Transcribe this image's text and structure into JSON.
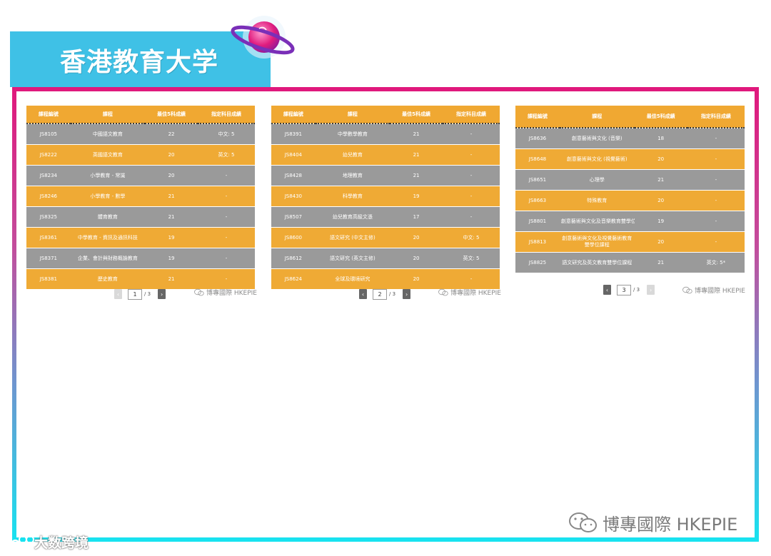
{
  "banner": {
    "title": "香港教育大学"
  },
  "columns": [
    "課程編號",
    "課程",
    "最佳5科成績",
    "指定科目成績"
  ],
  "panel3_columns": [
    "課程編號",
    "課程",
    "最佳5科成績",
    "指定科目成績"
  ],
  "panels": [
    {
      "rows": [
        {
          "code": "JS8105",
          "course": "中國語文教育",
          "score": "22",
          "req": "中文: 5"
        },
        {
          "code": "JS8222",
          "course": "英國語文教育",
          "score": "20",
          "req": "英文: 5"
        },
        {
          "code": "JS8234",
          "course": "小學教育 - 常識",
          "score": "20",
          "req": "-"
        },
        {
          "code": "JS8246",
          "course": "小學教育 - 數學",
          "score": "21",
          "req": "-"
        },
        {
          "code": "JS8325",
          "course": "體育教育",
          "score": "21",
          "req": "-"
        },
        {
          "code": "JS8361",
          "course": "中學教育 - 資訊及通訊科技",
          "score": "19",
          "req": "-"
        },
        {
          "code": "JS8371",
          "course": "企業、會計與財務概論教育",
          "score": "19",
          "req": "-"
        },
        {
          "code": "JS8381",
          "course": "歷史教育",
          "score": "21",
          "req": "-"
        }
      ],
      "pager": {
        "page": "1",
        "total": "/ 3"
      }
    },
    {
      "rows": [
        {
          "code": "JS8391",
          "course": "中學數學教育",
          "score": "21",
          "req": "-"
        },
        {
          "code": "JS8404",
          "course": "幼兒教育",
          "score": "21",
          "req": "-"
        },
        {
          "code": "JS8428",
          "course": "地理教育",
          "score": "21",
          "req": "-"
        },
        {
          "code": "JS8430",
          "course": "科學教育",
          "score": "19",
          "req": "-"
        },
        {
          "code": "JS8507",
          "course": "幼兒教育高級文憑",
          "score": "17",
          "req": "-"
        },
        {
          "code": "JS8600",
          "course": "語文研究 (中文主修)",
          "score": "20",
          "req": "中文: 5"
        },
        {
          "code": "JS8612",
          "course": "語文研究 (英文主修)",
          "score": "20",
          "req": "英文: 5"
        },
        {
          "code": "JS8624",
          "course": "全球及環境研究",
          "score": "20",
          "req": "-"
        }
      ],
      "pager": {
        "page": "2",
        "total": "/ 3"
      }
    },
    {
      "rows": [
        {
          "code": "JS8636",
          "course": "創意藝術與文化 (音樂)",
          "score": "18",
          "req": "-"
        },
        {
          "code": "JS8648",
          "course": "創意藝術與文化 (視覺藝術)",
          "score": "20",
          "req": "-"
        },
        {
          "code": "JS8651",
          "course": "心理學",
          "score": "21",
          "req": "-"
        },
        {
          "code": "JS8663",
          "course": "特殊教育",
          "score": "20",
          "req": "-"
        },
        {
          "code": "JS8801",
          "course": "創意藝術與文化及音樂教育雙學位課程",
          "score": "19",
          "req": "-"
        },
        {
          "code": "JS8813",
          "course": "創意藝術與文化及視覺藝術教育雙學位課程",
          "score": "20",
          "req": "-"
        },
        {
          "code": "JS8825",
          "course": "語文研究及英文教育雙學位課程",
          "score": "21",
          "req": "英文: 5*"
        }
      ],
      "pager": {
        "page": "3",
        "total": "/ 3"
      }
    }
  ],
  "small_watermark": "博專國際 HKEPIE",
  "big_watermark": "博專國際 HKEPIE",
  "corner_watermark": "大数跨境",
  "colors": {
    "orange": "#f0a832",
    "gray": "#9a9a9a",
    "banner": "#3fc1e6",
    "frame_top": "#e0187c",
    "frame_bottom": "#17e3f0"
  }
}
